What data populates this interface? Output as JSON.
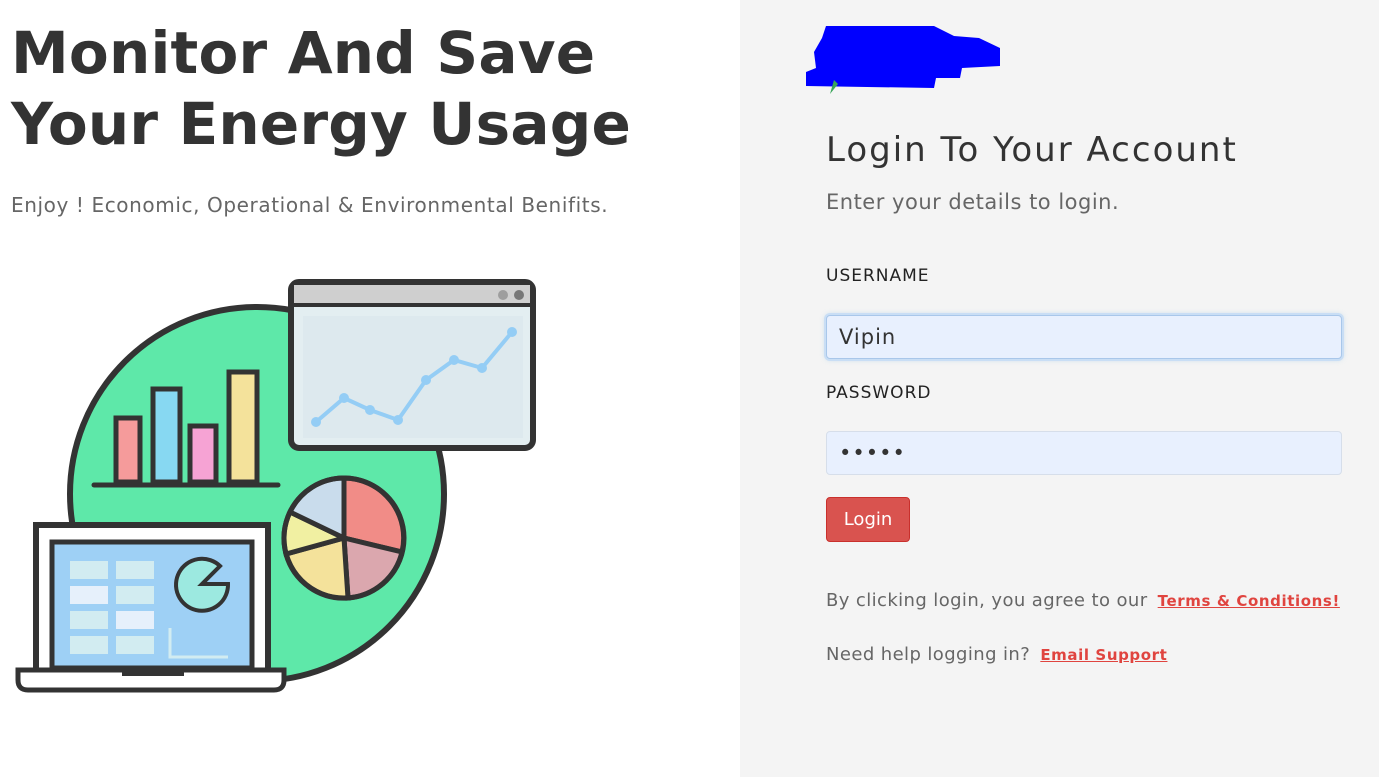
{
  "hero": {
    "title_line1": "Monitor And Save",
    "title_line2": "Your Energy Usage",
    "subtitle": "Enjoy ! Economic, Operational & Environmental Benifits.",
    "illustration": "analytics-dashboard-illustration"
  },
  "logo": {
    "name": "company-logo",
    "note": "redacted",
    "color": "#0000ff"
  },
  "login": {
    "title": "Login To Your Account",
    "subtitle": "Enter your details to login.",
    "username_label": "USERNAME",
    "username_value": "Vipin",
    "password_label": "PASSWORD",
    "password_value": "•••••",
    "button_label": "Login",
    "terms_text": "By clicking login, you agree to our",
    "terms_link": "Terms & Conditions!",
    "help_text": "Need help logging in?",
    "help_link": "Email Support"
  },
  "colors": {
    "accent": "#d9534f",
    "link": "#e0443f",
    "right_panel_bg": "#f4f4f4",
    "input_bg": "#e8f0fe",
    "illustration_circle": "#5ee8a9"
  }
}
